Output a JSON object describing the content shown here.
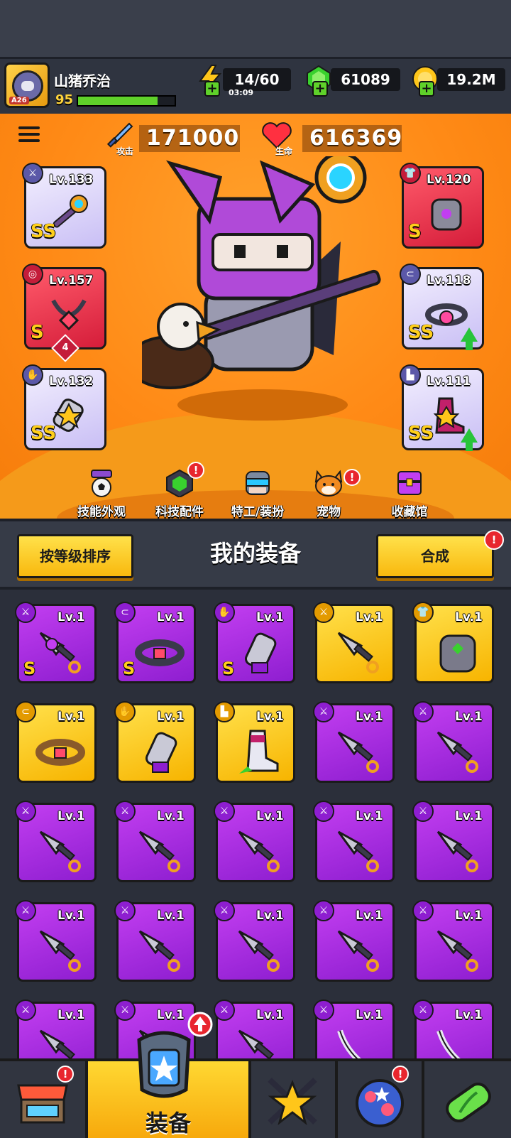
{
  "player": {
    "name": "山猪乔治",
    "level": "95",
    "avatar_tag": "A26",
    "xp_fraction": 0.82
  },
  "resources": {
    "energy": "14/60",
    "energy_timer": "03:09",
    "gems": "61089",
    "coins": "19.2M"
  },
  "stats": {
    "attack_label": "攻击",
    "attack_value": "171000",
    "hp_label": "生命",
    "hp_value": "616369"
  },
  "equipped": {
    "weapon": {
      "level": "Lv.133",
      "rank": "SS"
    },
    "armor": {
      "level": "Lv.120",
      "rank": "S"
    },
    "necklace": {
      "level": "Lv.157",
      "rank": "S",
      "badge": "4"
    },
    "belt": {
      "level": "Lv.118",
      "rank": "SS"
    },
    "gloves": {
      "level": "Lv.132",
      "rank": "SS"
    },
    "boots": {
      "level": "Lv.111",
      "rank": "SS"
    }
  },
  "features": [
    {
      "label": "技能外观"
    },
    {
      "label": "科技配件",
      "alert": "!"
    },
    {
      "label": "特工/装扮"
    },
    {
      "label": "宠物",
      "alert": "!"
    },
    {
      "label": "收藏馆"
    }
  ],
  "equip_section": {
    "sort_label": "按等级排序",
    "title": "我的装备",
    "merge_label": "合成",
    "merge_alert": "!"
  },
  "inventory": {
    "level": "Lv.1",
    "rank_s": "S"
  },
  "bottom_nav": {
    "shop_alert": "!",
    "equip_label": "装备",
    "pet_alert": "!"
  },
  "colors": {
    "epic": "#a62ee0",
    "legend": "#fbc31a",
    "accent_orange": "#ff8a16",
    "alert_red": "#e8262e"
  }
}
